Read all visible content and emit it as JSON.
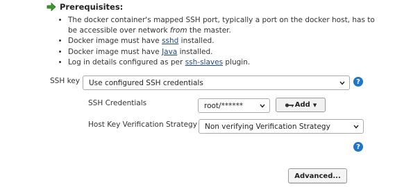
{
  "prerequisites": {
    "title": "Prerequisites:",
    "items": [
      {
        "text": "The docker container's mapped SSH port, typically a port on the docker host, has to be accessible over network ",
        "emphasis": "from",
        "after": " the master."
      },
      {
        "before": "Docker image must have ",
        "link": "sshd",
        "after": " installed."
      },
      {
        "before": "Docker image must have ",
        "link": "Java",
        "after": " installed."
      },
      {
        "before": "Log in details configured as per ",
        "link": "ssh-slaves",
        "after": " plugin."
      }
    ]
  },
  "ssh_key": {
    "label": "SSH key",
    "selected": "Use configured SSH credentials"
  },
  "ssh_credentials": {
    "label": "SSH Credentials",
    "selected": "root/******",
    "add_label": "Add"
  },
  "host_key": {
    "label": "Host Key Verification Strategy",
    "selected": "Non verifying Verification Strategy"
  },
  "help": {
    "glyph": "?"
  },
  "advanced_label": "Advanced...",
  "colors": {
    "help_blue": "#1f76c9",
    "link": "#204a87",
    "arrow_green": "#3a9a28"
  }
}
